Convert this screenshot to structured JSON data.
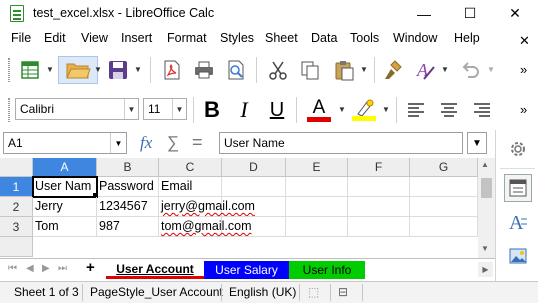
{
  "window": {
    "title": "test_excel.xlsx - LibreOffice Calc",
    "controls": {
      "minimize": "—",
      "maximize": "☐",
      "close": "✕"
    }
  },
  "menubar": {
    "items": [
      {
        "label": "File"
      },
      {
        "label": "Edit"
      },
      {
        "label": "View"
      },
      {
        "label": "Insert"
      },
      {
        "label": "Format"
      },
      {
        "label": "Styles"
      },
      {
        "label": "Sheet"
      },
      {
        "label": "Data"
      },
      {
        "label": "Tools"
      },
      {
        "label": "Window"
      },
      {
        "label": "Help"
      }
    ],
    "close_document": "✕"
  },
  "formatting": {
    "font_name": "Calibri",
    "font_size": "11",
    "font_color": "#e00000",
    "highlight_color": "#ffff00"
  },
  "formula_bar": {
    "name_box": "A1",
    "content": "User Name",
    "function_wizard": "fx",
    "sum_symbol": "∑",
    "equals_symbol": "="
  },
  "sheet": {
    "columns": [
      "A",
      "B",
      "C",
      "D",
      "E",
      "F",
      "G"
    ],
    "selected_column": "A",
    "rows": [
      {
        "header": "1",
        "cells": [
          "User Nam",
          "Password",
          "Email",
          "",
          "",
          "",
          ""
        ]
      },
      {
        "header": "2",
        "cells": [
          "Jerry",
          "1234567",
          "jerry@gmail.com",
          "",
          "",
          "",
          ""
        ]
      },
      {
        "header": "3",
        "cells": [
          "Tom",
          "987",
          "tom@gmail.com",
          "",
          "",
          "",
          ""
        ]
      }
    ],
    "active_cell": "A1"
  },
  "tabs": {
    "add_label": "+",
    "sheets": [
      {
        "label": "User Account",
        "color": "#ffffff",
        "underline": "#e00000"
      },
      {
        "label": "User Salary",
        "color": "#0000ff",
        "text_color": "#ffffff"
      },
      {
        "label": "User Info",
        "color": "#00cc00",
        "text_color": "#000000"
      }
    ]
  },
  "status": {
    "sheet_position": "Sheet 1 of 3",
    "page_style": "PageStyle_User Account",
    "language": "English (UK)"
  },
  "icons": [
    "calc-app-icon",
    "new-spreadsheet-icon",
    "open-folder-icon",
    "save-icon",
    "export-pdf-icon",
    "print-icon",
    "print-preview-icon",
    "cut-icon",
    "copy-icon",
    "paste-icon",
    "clone-formatting-icon",
    "clear-formatting-icon",
    "undo-icon",
    "bold-icon",
    "italic-icon",
    "underline-icon",
    "font-color-icon",
    "highlight-icon",
    "align-left-icon",
    "align-center-icon",
    "align-right-icon",
    "settings-icon",
    "properties-icon",
    "styles-icon",
    "gallery-icon"
  ]
}
